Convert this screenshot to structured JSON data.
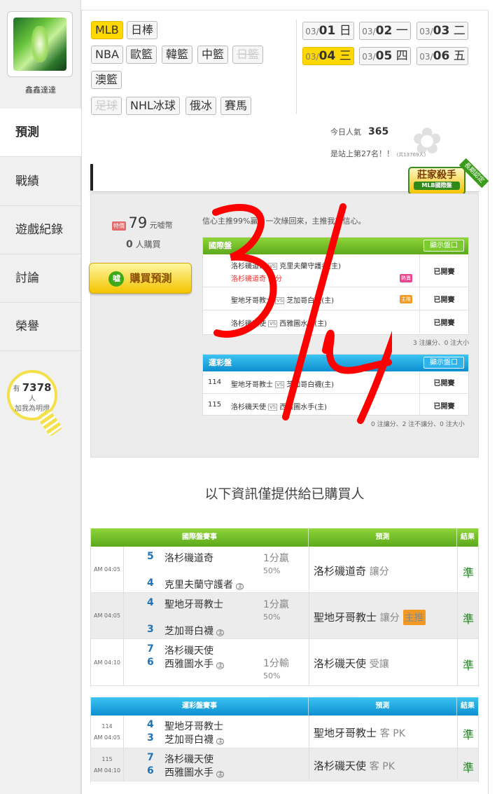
{
  "sidebar": {
    "username": "鑫鑫達達",
    "nav": [
      "預測",
      "戰績",
      "遊戲紀錄",
      "討論",
      "榮譽"
    ],
    "fans_prefix": "有",
    "fans_count": "7378",
    "fans_unit": "人",
    "fans_caption": "加我為明燈"
  },
  "sports": [
    "MLB",
    "日棒",
    "NBA",
    "歐籃",
    "韓籃",
    "中籃",
    "日籃",
    "澳籃",
    "足球",
    "NHL冰球",
    "俄冰",
    "賽馬"
  ],
  "dates": [
    {
      "md": "03/",
      "d": "01",
      "w": "日"
    },
    {
      "md": "03/",
      "d": "02",
      "w": "一"
    },
    {
      "md": "03/",
      "d": "03",
      "w": "二"
    },
    {
      "md": "03/",
      "d": "04",
      "w": "三"
    },
    {
      "md": "03/",
      "d": "05",
      "w": "四"
    },
    {
      "md": "03/",
      "d": "06",
      "w": "五"
    }
  ],
  "stats": {
    "popularity_label": "今日人氣",
    "popularity_value": "365",
    "rank_text": "是站上第27名！！",
    "rank_small": "(共13769人)"
  },
  "badge": {
    "title": "莊家殺手",
    "sub": "MLB國際盤",
    "ribbon": "長期認定"
  },
  "purchase": {
    "price_icon": "特價",
    "price": "79",
    "price_unit": "元嘘幣",
    "buyers": "0",
    "buyers_label": "人購買",
    "buy_button": "購買預測",
    "buy_icon": "嘘",
    "confidence_text": "信心主推99%贏，一次綠回來，主推我有信心。"
  },
  "intl_box": {
    "title": "國際盤",
    "show_button": "顯示盤口",
    "rows": [
      {
        "away": "洛杉磯道奇",
        "home": "克里夫蘭守護者(主)",
        "pick": "洛杉磯道奇 讓分",
        "tag": "熱賣",
        "status": "已開賽"
      },
      {
        "away": "聖地牙哥教士",
        "home": "芝加哥白襪(主)",
        "pick": "",
        "tag": "主推",
        "status": "已開賽"
      },
      {
        "away": "洛杉磯天使",
        "home": "西雅圖水手(主)",
        "pick": "",
        "tag": "",
        "status": "已開賽"
      }
    ],
    "note": "3 注讓分、0 注大小"
  },
  "lottery_box": {
    "title": "運彩盤",
    "show_button": "顯示盤口",
    "rows": [
      {
        "no": "114",
        "away": "聖地牙哥教士",
        "home": "芝加哥白襪(主)",
        "status": "已開賽"
      },
      {
        "no": "115",
        "away": "洛杉磯天使",
        "home": "西雅圖水手(主)",
        "status": "已開賽"
      }
    ],
    "note": "0 注讓分、2 注不讓分、0 注大小"
  },
  "info_title": "以下資訊僅提供給已購買人",
  "table1": {
    "headers": [
      "國際盤賽事",
      "預測",
      "結果"
    ],
    "rows": [
      {
        "time": "AM 04:05",
        "s1": "5",
        "t1": "洛杉磯道奇",
        "s2": "4",
        "t2": "克里夫蘭守護者",
        "odd1": "1分贏",
        "odd2": "50%",
        "pick": "洛杉磯道奇",
        "pick_type": "讓分",
        "res": "準"
      },
      {
        "time": "AM 04:05",
        "s1": "4",
        "t1": "聖地牙哥教士",
        "s2": "3",
        "t2": "芝加哥白襪",
        "odd1": "1分贏",
        "odd2": "50%",
        "pick": "聖地牙哥教士",
        "pick_type": "讓分",
        "res": "準"
      },
      {
        "time": "AM 04:10",
        "s1": "7",
        "t1": "洛杉磯天使",
        "s2": "6",
        "t2": "西雅圖水手",
        "odd1": "1分輸",
        "odd2": "50%",
        "pick": "洛杉磯天使",
        "pick_type": "受讓",
        "res": "準"
      }
    ],
    "home_mark": "主",
    "tag": "主推"
  },
  "table2": {
    "headers": [
      "運彩盤賽事",
      "預測",
      "結果"
    ],
    "rows": [
      {
        "no": "114",
        "time": "AM 04:05",
        "s1": "4",
        "t1": "聖地牙哥教士",
        "s2": "3",
        "t2": "芝加哥白襪",
        "pick": "聖地牙哥教士",
        "pick_type": "客 PK",
        "res": "準"
      },
      {
        "no": "115",
        "time": "AM 04:10",
        "s1": "7",
        "t1": "洛杉磯天使",
        "s2": "6",
        "t2": "西雅圖水手",
        "pick": "洛杉磯天使",
        "pick_type": "客 PK",
        "res": "準"
      }
    ]
  },
  "colors": {
    "accent_yellow": "#ffd800",
    "green_header": "#5ca91c",
    "blue_header": "#0d8fd0",
    "result_green": "#1a8a1a",
    "handwriting_red": "#ff0000"
  }
}
